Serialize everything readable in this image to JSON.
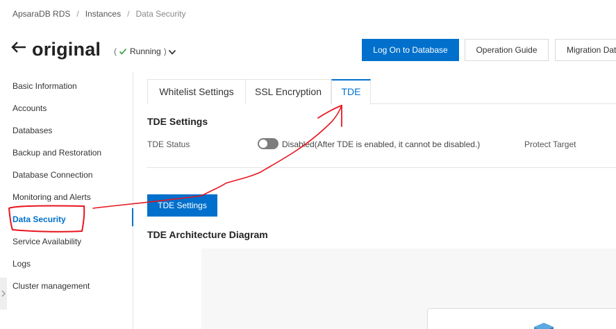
{
  "breadcrumb": {
    "items": [
      "ApsaraDB RDS",
      "Instances",
      "Data Security"
    ],
    "separator": "/"
  },
  "header": {
    "instance_name": "original",
    "status_open": "(",
    "status": "Running",
    "status_close": ")",
    "buttons": {
      "logon": "Log On to Database",
      "guide": "Operation Guide",
      "migration": "Migration Dat"
    }
  },
  "sidebar": {
    "items": [
      "Basic Information",
      "Accounts",
      "Databases",
      "Backup and Restoration",
      "Database Connection",
      "Monitoring and Alerts",
      "Data Security",
      "Service Availability",
      "Logs",
      "Cluster management"
    ],
    "active_index": 6
  },
  "tabs": [
    "Whitelist Settings",
    "SSL Encryption",
    "TDE"
  ],
  "tde": {
    "section_title": "TDE Settings",
    "status_label": "TDE Status",
    "toggle_enabled": false,
    "toggle_text": "Disabled(After TDE is enabled, it cannot be disabled.)",
    "protect_target_label": "Protect Target",
    "settings_button": "TDE Settings",
    "diagram_title": "TDE Architecture Diagram"
  },
  "colors": {
    "accent": "#0070cc",
    "running": "#2e9e3e",
    "annotation_stroke": "#e8141e",
    "toggle_off": "#7d7d7d"
  },
  "icons": {
    "back": "arrow-left-icon",
    "status": "check-icon",
    "status_menu": "chevron-down-icon",
    "collapse": "chevron-right-icon"
  }
}
